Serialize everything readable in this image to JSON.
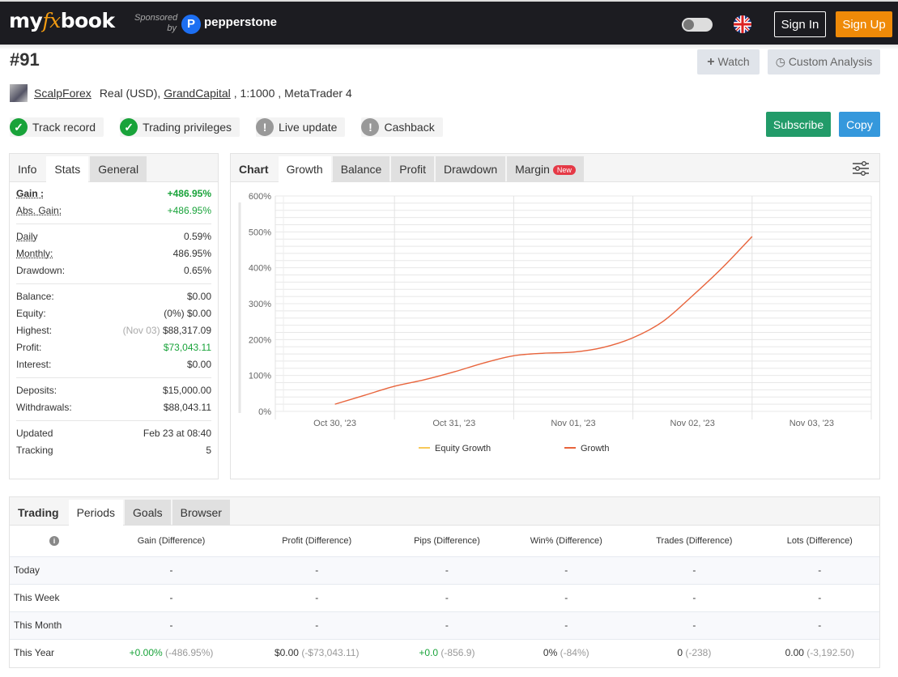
{
  "header": {
    "logo": {
      "pre": "my",
      "fx": "fx",
      "post": "book"
    },
    "sponsored_by": "Sponsored by",
    "sponsor_name": "pepperstone",
    "sponsor_badge": "P",
    "sign_in": "Sign In",
    "sign_up": "Sign Up"
  },
  "account": {
    "title": "#91",
    "user": "ScalpForex",
    "type": "Real (USD),",
    "broker": "GrandCapital",
    "leverage": ", 1:1000 ,",
    "platform": "MetaTrader 4",
    "watch_label": "Watch",
    "custom_analysis_label": "Custom Analysis",
    "subscribe_label": "Subscribe",
    "copy_label": "Copy",
    "badges": [
      {
        "label": "Track record",
        "status": "ok",
        "icon": "check-icon"
      },
      {
        "label": "Trading privileges",
        "status": "ok",
        "icon": "check-icon"
      },
      {
        "label": "Live update",
        "status": "warn",
        "icon": "exclamation-icon"
      },
      {
        "label": "Cashback",
        "status": "warn",
        "icon": "exclamation-icon"
      }
    ]
  },
  "stats_panel": {
    "tabs": [
      "Info",
      "Stats",
      "General"
    ],
    "gain": {
      "label": "Gain :",
      "value": "+486.95%"
    },
    "abs_gain": {
      "label": "Abs. Gain:",
      "value": "+486.95%"
    },
    "daily": {
      "label": "Daily",
      "value": "0.59%"
    },
    "monthly": {
      "label": "Monthly:",
      "value": "486.95%"
    },
    "drawdown": {
      "label": "Drawdown:",
      "value": "0.65%"
    },
    "balance": {
      "label": "Balance:",
      "value": "$0.00"
    },
    "equity": {
      "label": "Equity:",
      "prefix": "(0%)",
      "value": "$0.00"
    },
    "highest": {
      "label": "Highest:",
      "prefix": "(Nov 03)",
      "value": "$88,317.09"
    },
    "profit": {
      "label": "Profit:",
      "value": "$73,043.11"
    },
    "interest": {
      "label": "Interest:",
      "value": "$0.00"
    },
    "deposits": {
      "label": "Deposits:",
      "value": "$15,000.00"
    },
    "withdrawals": {
      "label": "Withdrawals:",
      "value": "$88,043.11"
    },
    "updated": {
      "label": "Updated",
      "value": "Feb 23 at 08:40"
    },
    "tracking": {
      "label": "Tracking",
      "value": "5"
    }
  },
  "chart_panel": {
    "tabs": [
      "Chart",
      "Growth",
      "Balance",
      "Profit",
      "Drawdown",
      "Margin"
    ],
    "new_badge": "New"
  },
  "chart_data": {
    "type": "line",
    "title": "",
    "xlabel": "",
    "ylabel": "",
    "x": [
      "Oct 30, '23",
      "Oct 31, '23",
      "Nov 01, '23",
      "Nov 02, '23",
      "Nov 03, '23"
    ],
    "y_ticks": [
      "0%",
      "100%",
      "200%",
      "300%",
      "400%",
      "500%",
      "600%"
    ],
    "ylim": [
      0,
      600
    ],
    "grid": true,
    "legend_position": "bottom",
    "series": [
      {
        "name": "Equity Growth",
        "color": "#f7c95a",
        "values": []
      },
      {
        "name": "Growth",
        "color": "#e8643c",
        "values": [
          20,
          110,
          160,
          300,
          487
        ]
      }
    ],
    "curve_points": [
      [
        0,
        20
      ],
      [
        0.25,
        45
      ],
      [
        0.5,
        70
      ],
      [
        0.75,
        88
      ],
      [
        1,
        110
      ],
      [
        1.25,
        135
      ],
      [
        1.5,
        155
      ],
      [
        1.75,
        162
      ],
      [
        2,
        165
      ],
      [
        2.25,
        178
      ],
      [
        2.5,
        205
      ],
      [
        2.75,
        250
      ],
      [
        3,
        322
      ],
      [
        3.25,
        400
      ],
      [
        3.5,
        487
      ]
    ]
  },
  "periods_panel": {
    "tabs": [
      "Trading",
      "Periods",
      "Goals",
      "Browser"
    ],
    "columns": [
      "Gain (Difference)",
      "Profit (Difference)",
      "Pips (Difference)",
      "Win% (Difference)",
      "Trades (Difference)",
      "Lots (Difference)"
    ],
    "rows": [
      {
        "label": "Today",
        "cells": [
          {
            "v": "-",
            "d": ""
          },
          {
            "v": "-",
            "d": ""
          },
          {
            "v": "-",
            "d": ""
          },
          {
            "v": "-",
            "d": ""
          },
          {
            "v": "-",
            "d": ""
          },
          {
            "v": "-",
            "d": ""
          }
        ]
      },
      {
        "label": "This Week",
        "cells": [
          {
            "v": "-",
            "d": ""
          },
          {
            "v": "-",
            "d": ""
          },
          {
            "v": "-",
            "d": ""
          },
          {
            "v": "-",
            "d": ""
          },
          {
            "v": "-",
            "d": ""
          },
          {
            "v": "-",
            "d": ""
          }
        ]
      },
      {
        "label": "This Month",
        "cells": [
          {
            "v": "-",
            "d": ""
          },
          {
            "v": "-",
            "d": ""
          },
          {
            "v": "-",
            "d": ""
          },
          {
            "v": "-",
            "d": ""
          },
          {
            "v": "-",
            "d": ""
          },
          {
            "v": "-",
            "d": ""
          }
        ]
      },
      {
        "label": "This Year",
        "cells": [
          {
            "v": "+0.00%",
            "d": "(-486.95%)",
            "green": true
          },
          {
            "v": "$0.00",
            "d": "(-$73,043.11)"
          },
          {
            "v": "+0.0",
            "d": "(-856.9)",
            "green": true
          },
          {
            "v": "0%",
            "d": "(-84%)"
          },
          {
            "v": "0",
            "d": "(-238)"
          },
          {
            "v": "0.00",
            "d": "(-3,192.50)"
          }
        ]
      }
    ]
  }
}
